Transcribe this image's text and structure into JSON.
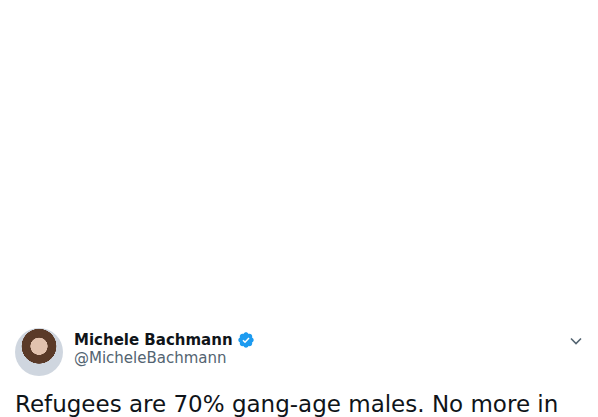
{
  "author": {
    "name": "Michele Bachmann",
    "handle": "@MicheleBachmann",
    "verified": true
  },
  "tweet": {
    "text": "Refugees are 70% gang-age males. No more in"
  }
}
